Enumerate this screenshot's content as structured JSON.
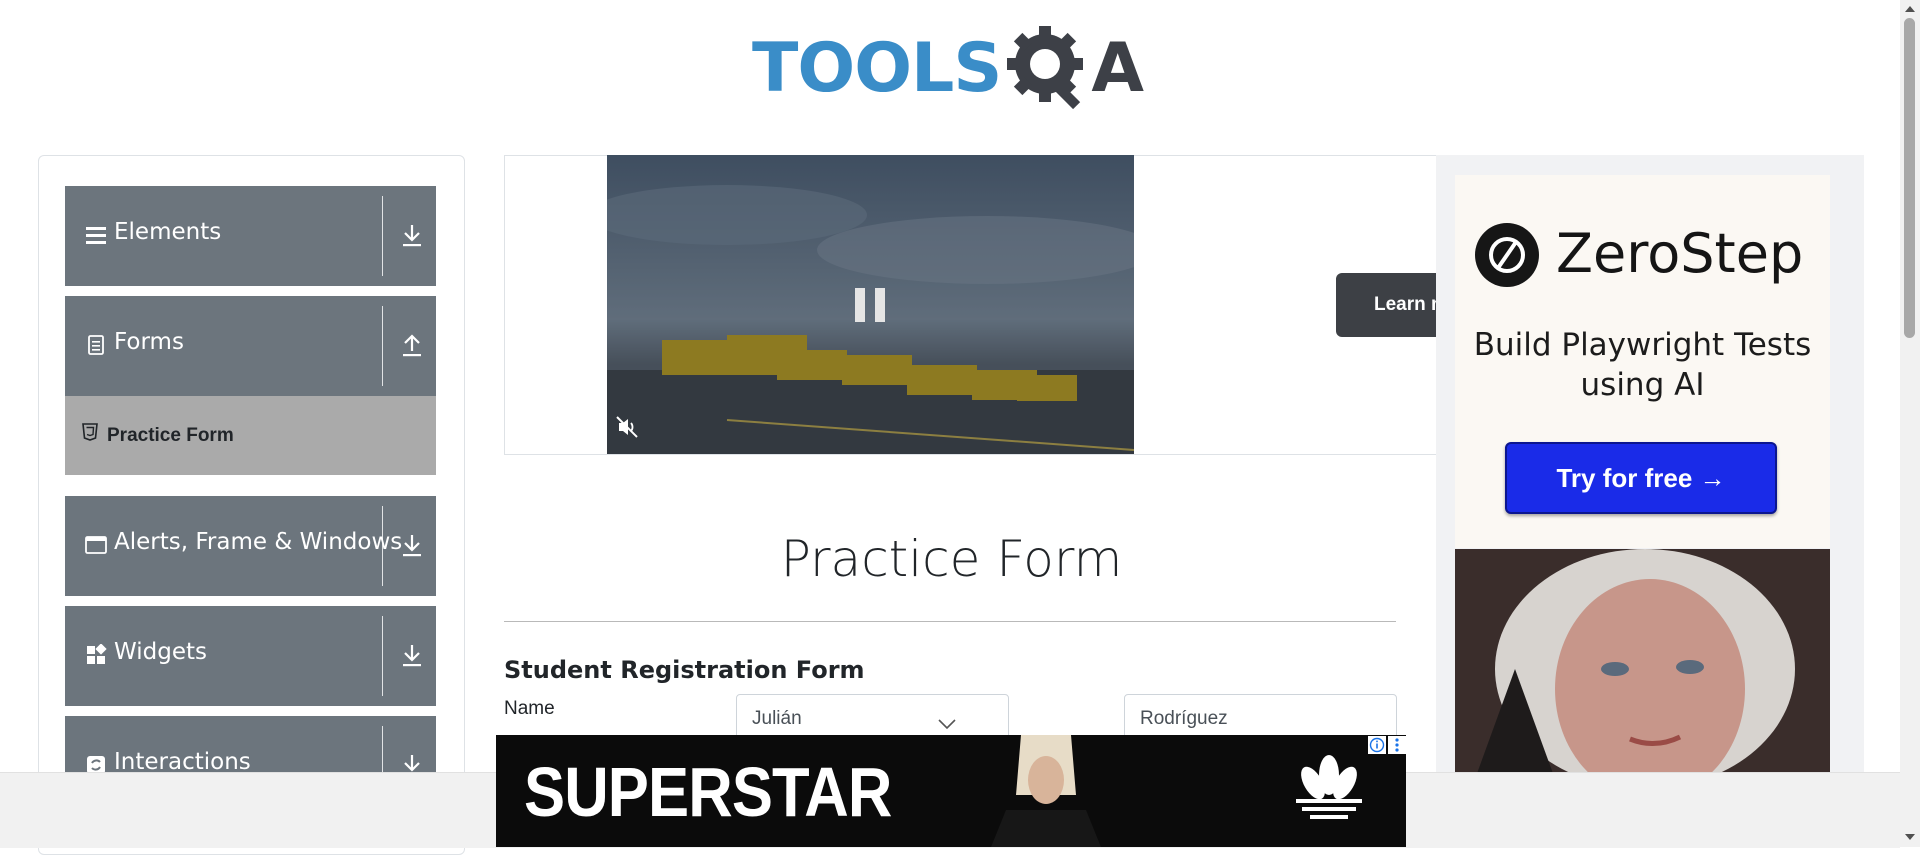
{
  "header": {
    "logo_text": "TOOLS",
    "logo_suffix": "A"
  },
  "sidebar": {
    "groups": [
      {
        "label": "Elements",
        "icon": "list-icon",
        "arrow": "download-arrow-icon"
      },
      {
        "label": "Forms",
        "icon": "form-icon",
        "arrow": "upload-arrow-icon"
      },
      {
        "label": "Alerts, Frame & Windows",
        "icon": "window-icon",
        "arrow": "download-arrow-icon"
      },
      {
        "label": "Widgets",
        "icon": "widgets-icon",
        "arrow": "download-arrow-icon"
      },
      {
        "label": "Interactions",
        "icon": "interactions-icon",
        "arrow": "download-arrow-icon"
      }
    ],
    "active_item": {
      "label": "Practice Form",
      "icon": "html5-icon"
    }
  },
  "video_ad": {
    "learn_more_label": "Learn more",
    "state": "playing"
  },
  "right_ad": {
    "brand": "ZeroStep",
    "tagline": "Build Playwright Tests using AI",
    "cta": "Try for free →",
    "colors": {
      "cta": "#1a2be8"
    }
  },
  "form": {
    "title": "Practice Form",
    "subtitle": "Student Registration Form",
    "name_label": "Name",
    "first_name_value": "Julián",
    "last_name_value": "Rodríguez"
  },
  "banner_ad": {
    "text": "SUPERSTAR",
    "brand_icon": "adidas-logo-icon"
  },
  "colors": {
    "logo_blue": "#3a8dc8",
    "logo_dark": "#3d4047",
    "sidebar_group": "#6c757d",
    "sidebar_active": "#aaaaaa"
  }
}
